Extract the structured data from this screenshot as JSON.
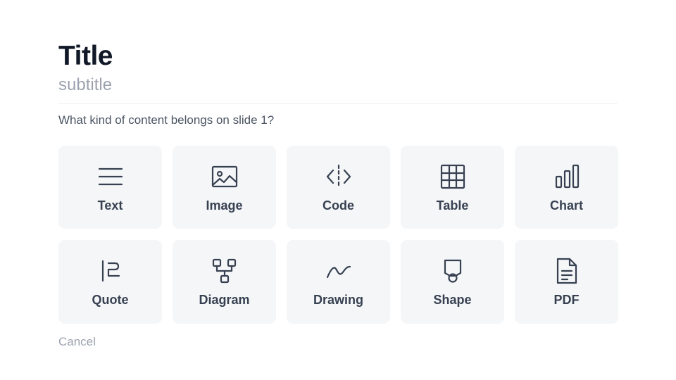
{
  "header": {
    "title": "Title",
    "subtitle": "subtitle"
  },
  "prompt": {
    "question": "What kind of content belongs on slide 1?"
  },
  "content_types": [
    {
      "label": "Text",
      "icon": "text-lines-icon"
    },
    {
      "label": "Image",
      "icon": "image-icon"
    },
    {
      "label": "Code",
      "icon": "code-icon"
    },
    {
      "label": "Table",
      "icon": "table-icon"
    },
    {
      "label": "Chart",
      "icon": "bar-chart-icon"
    },
    {
      "label": "Quote",
      "icon": "quote-icon"
    },
    {
      "label": "Diagram",
      "icon": "diagram-icon"
    },
    {
      "label": "Drawing",
      "icon": "drawing-icon"
    },
    {
      "label": "Shape",
      "icon": "shape-icon"
    },
    {
      "label": "PDF",
      "icon": "pdf-file-icon"
    }
  ],
  "footer": {
    "cancel_label": "Cancel"
  },
  "colors": {
    "title": "#111827",
    "subtitle": "#9ca3af",
    "card_background": "#f5f6f8",
    "icon_and_label": "#374151",
    "question": "#4b5563"
  }
}
